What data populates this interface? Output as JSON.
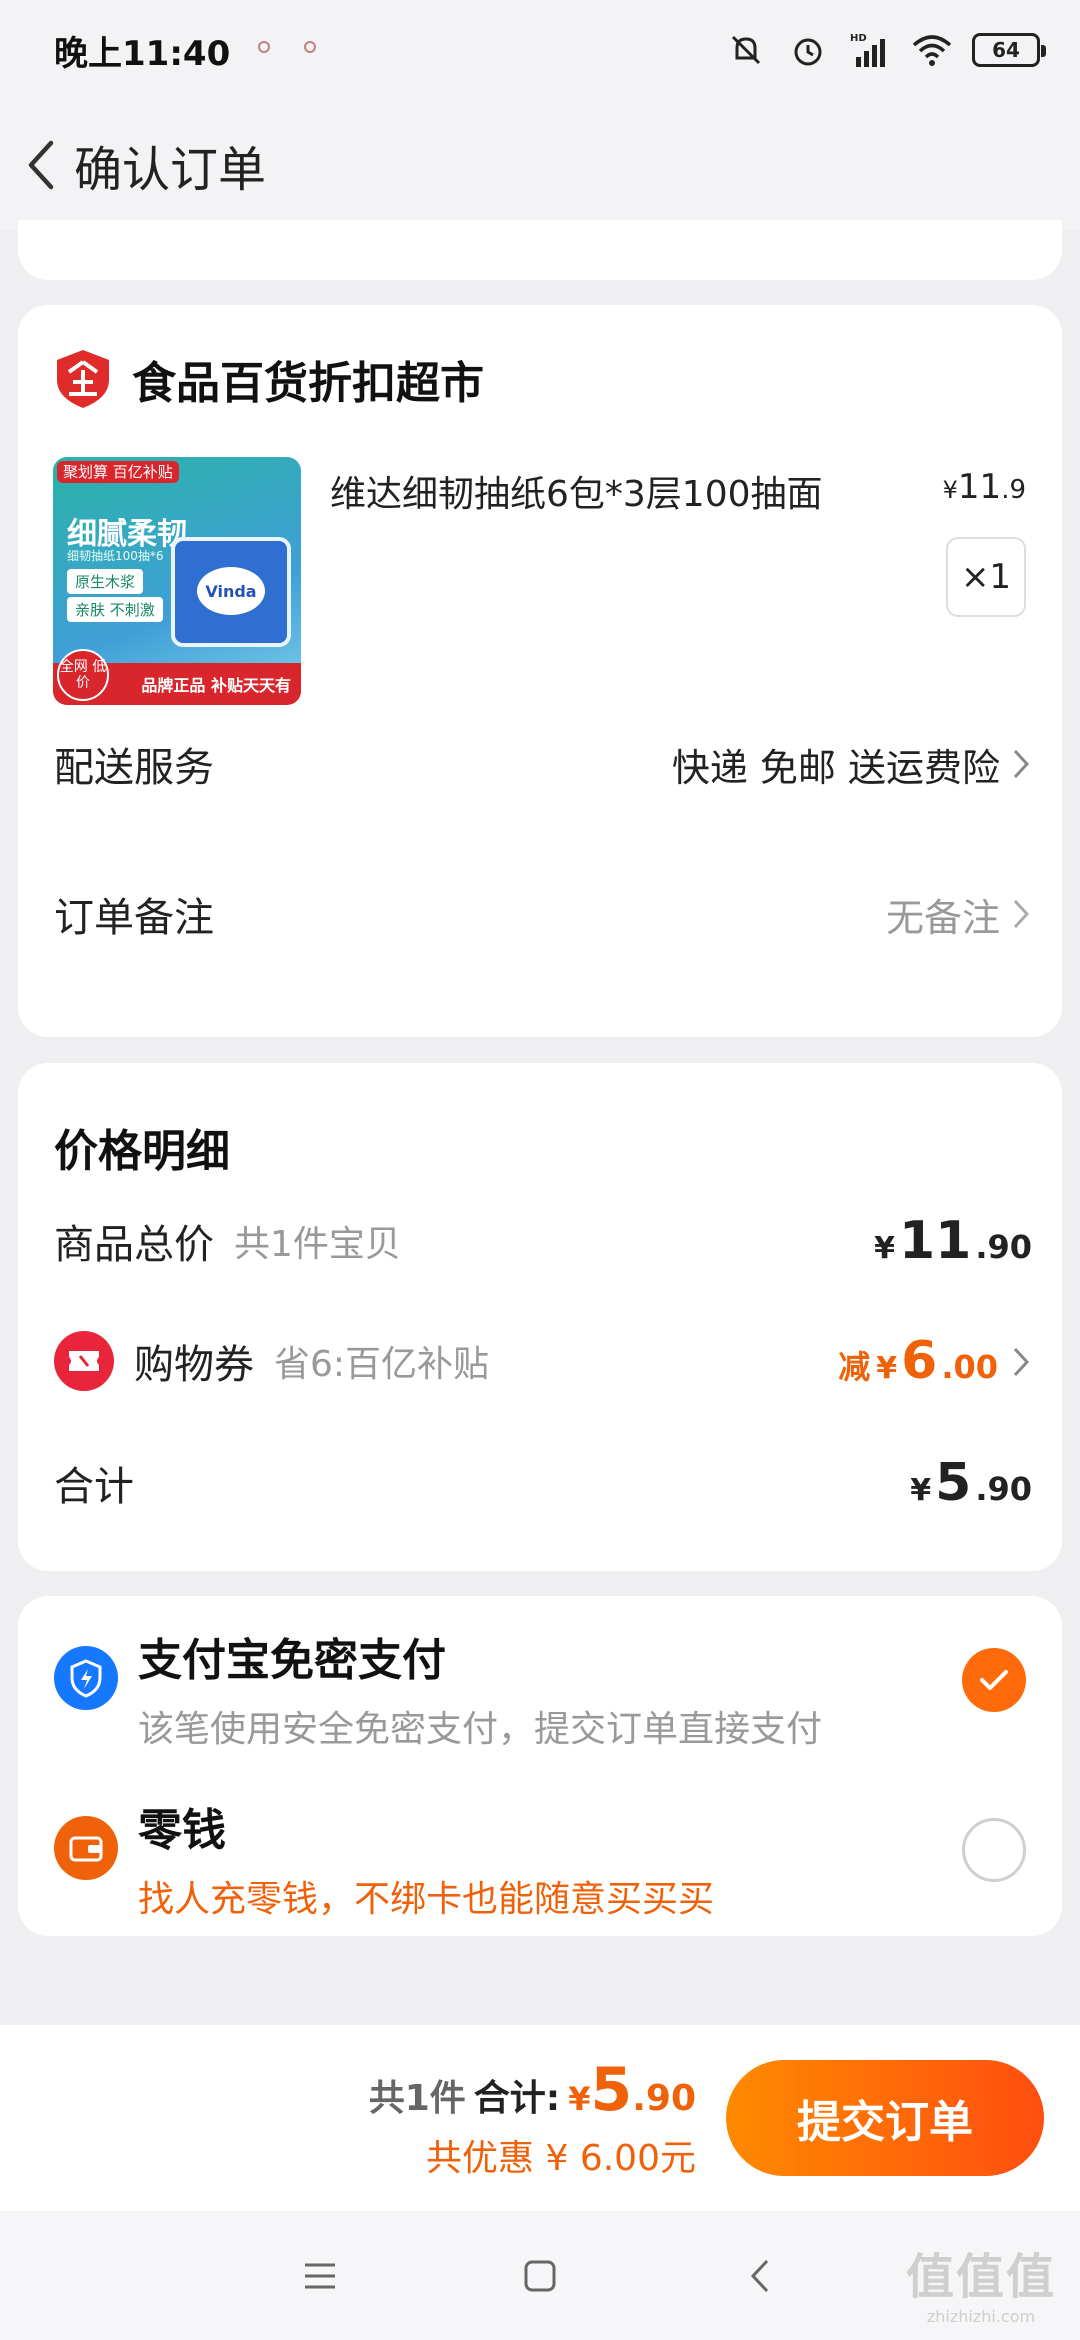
{
  "status_bar": {
    "time": "晚上11:40",
    "battery": "64",
    "network": "HD"
  },
  "nav": {
    "title": "确认订单"
  },
  "order": {
    "shop_name": "食品百货折扣超市",
    "product": {
      "name": "维达细韧抽纸6包*3层100抽面",
      "price_yen": "¥",
      "price_int": "11",
      "price_dec": ".9",
      "quantity": "×1",
      "image": {
        "tag": "聚划算 百亿补贴",
        "title": "细腻柔韧",
        "subtitle": "细韧抽纸100抽*6",
        "chip1": "原生木浆",
        "chip2": "亲肤 不刺激",
        "brand": "Vinda",
        "badge": "全网 低价",
        "footer": "品牌正品 补贴天天有"
      }
    },
    "delivery": {
      "label": "配送服务",
      "value": "快递 免邮 送运费险"
    },
    "note": {
      "label": "订单备注",
      "value": "无备注"
    }
  },
  "price_detail": {
    "title": "价格明细",
    "goods_total": {
      "label": "商品总价",
      "sub": "共1件宝贝",
      "yen": "¥",
      "int": "11",
      "dec": ".90"
    },
    "coupon": {
      "label": "购物券",
      "sub": "省6:百亿补贴",
      "prefix": "减",
      "yen": "¥",
      "int": "6",
      "dec": ".00"
    },
    "total": {
      "label": "合计",
      "yen": "¥",
      "int": "5",
      "dec": ".90"
    }
  },
  "payment": {
    "options": [
      {
        "title": "支付宝免密支付",
        "desc": "该笔使用安全免密支付，提交订单直接支付",
        "selected": true
      },
      {
        "title": "零钱",
        "desc": "找人充零钱，不绑卡也能随意买买买",
        "selected": false
      }
    ]
  },
  "bottom": {
    "count": "共1件",
    "total_label": "合计:",
    "yen": "¥",
    "int": "5",
    "dec": ".90",
    "savings": "共优惠 ¥ 6.00元",
    "submit": "提交订单"
  },
  "watermark": {
    "big": "值值值",
    "small": "zhizhizhi.com"
  },
  "colors": {
    "accent": "#f0620a",
    "button_start": "#ff8a00",
    "button_end": "#ff4e10",
    "alipay_blue": "#1677ff",
    "coupon_red": "#e8253a"
  }
}
